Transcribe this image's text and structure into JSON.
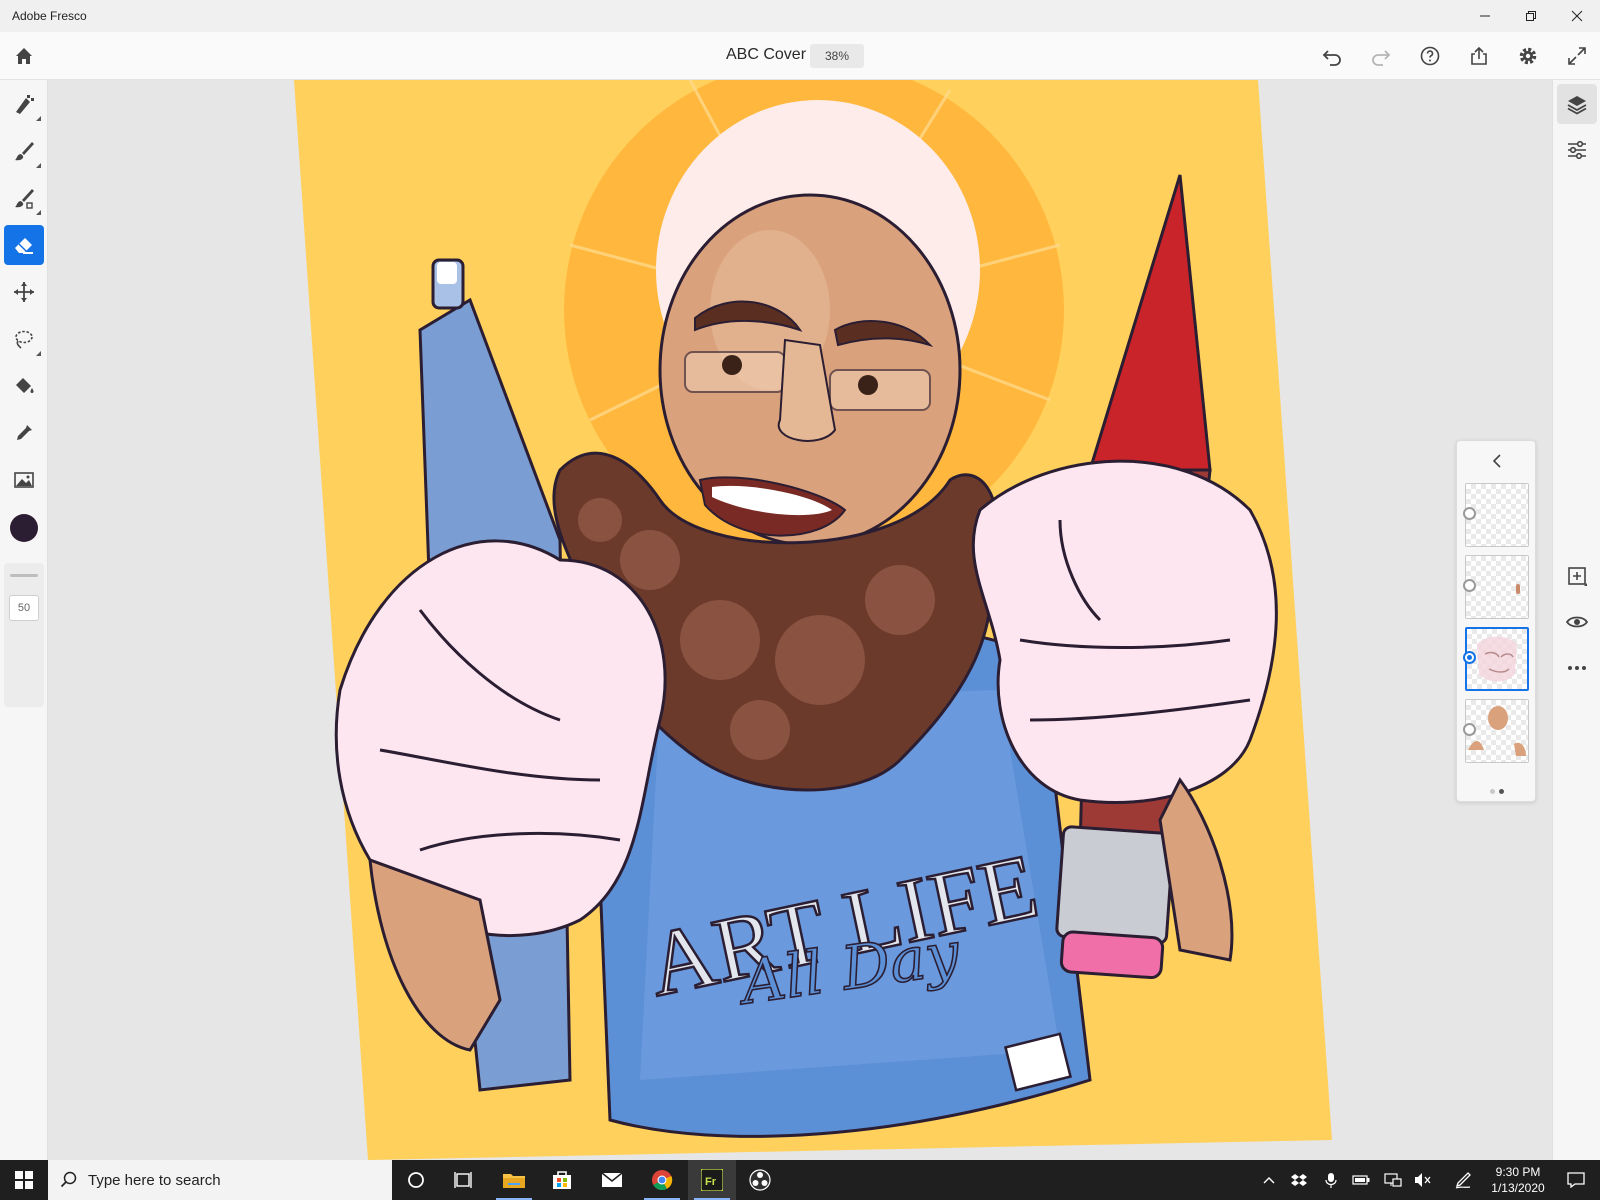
{
  "window": {
    "title": "Adobe Fresco"
  },
  "header": {
    "doc_title": "ABC Cover",
    "zoom": "38%"
  },
  "tools": [
    {
      "name": "pixel-brush",
      "active": false
    },
    {
      "name": "live-brush",
      "active": false
    },
    {
      "name": "vector-brush",
      "active": false
    },
    {
      "name": "eraser",
      "active": true
    },
    {
      "name": "transform",
      "active": false
    },
    {
      "name": "selection",
      "active": false
    },
    {
      "name": "fill",
      "active": false
    },
    {
      "name": "eyedropper",
      "active": false
    },
    {
      "name": "place-image",
      "active": false
    }
  ],
  "brush": {
    "size": "50",
    "color": "#2b1e33"
  },
  "layers": [
    {
      "name": "layer-1",
      "active": false
    },
    {
      "name": "layer-2",
      "active": false
    },
    {
      "name": "layer-3",
      "active": true
    },
    {
      "name": "layer-4",
      "active": false
    }
  ],
  "artwork": {
    "shirt_text": "ART LIFE",
    "script_text": "All Day",
    "background": "#ffd15c",
    "halo": "#ffb83d",
    "shirt": "#5b8fd6",
    "skin": "#d9a27c",
    "beard": "#6b3a2a",
    "glove": "#fde6ef"
  },
  "taskbar": {
    "search_placeholder": "Type here to search",
    "time": "9:30 PM",
    "date": "1/13/2020"
  },
  "colors": {
    "accent": "#1473e6"
  }
}
